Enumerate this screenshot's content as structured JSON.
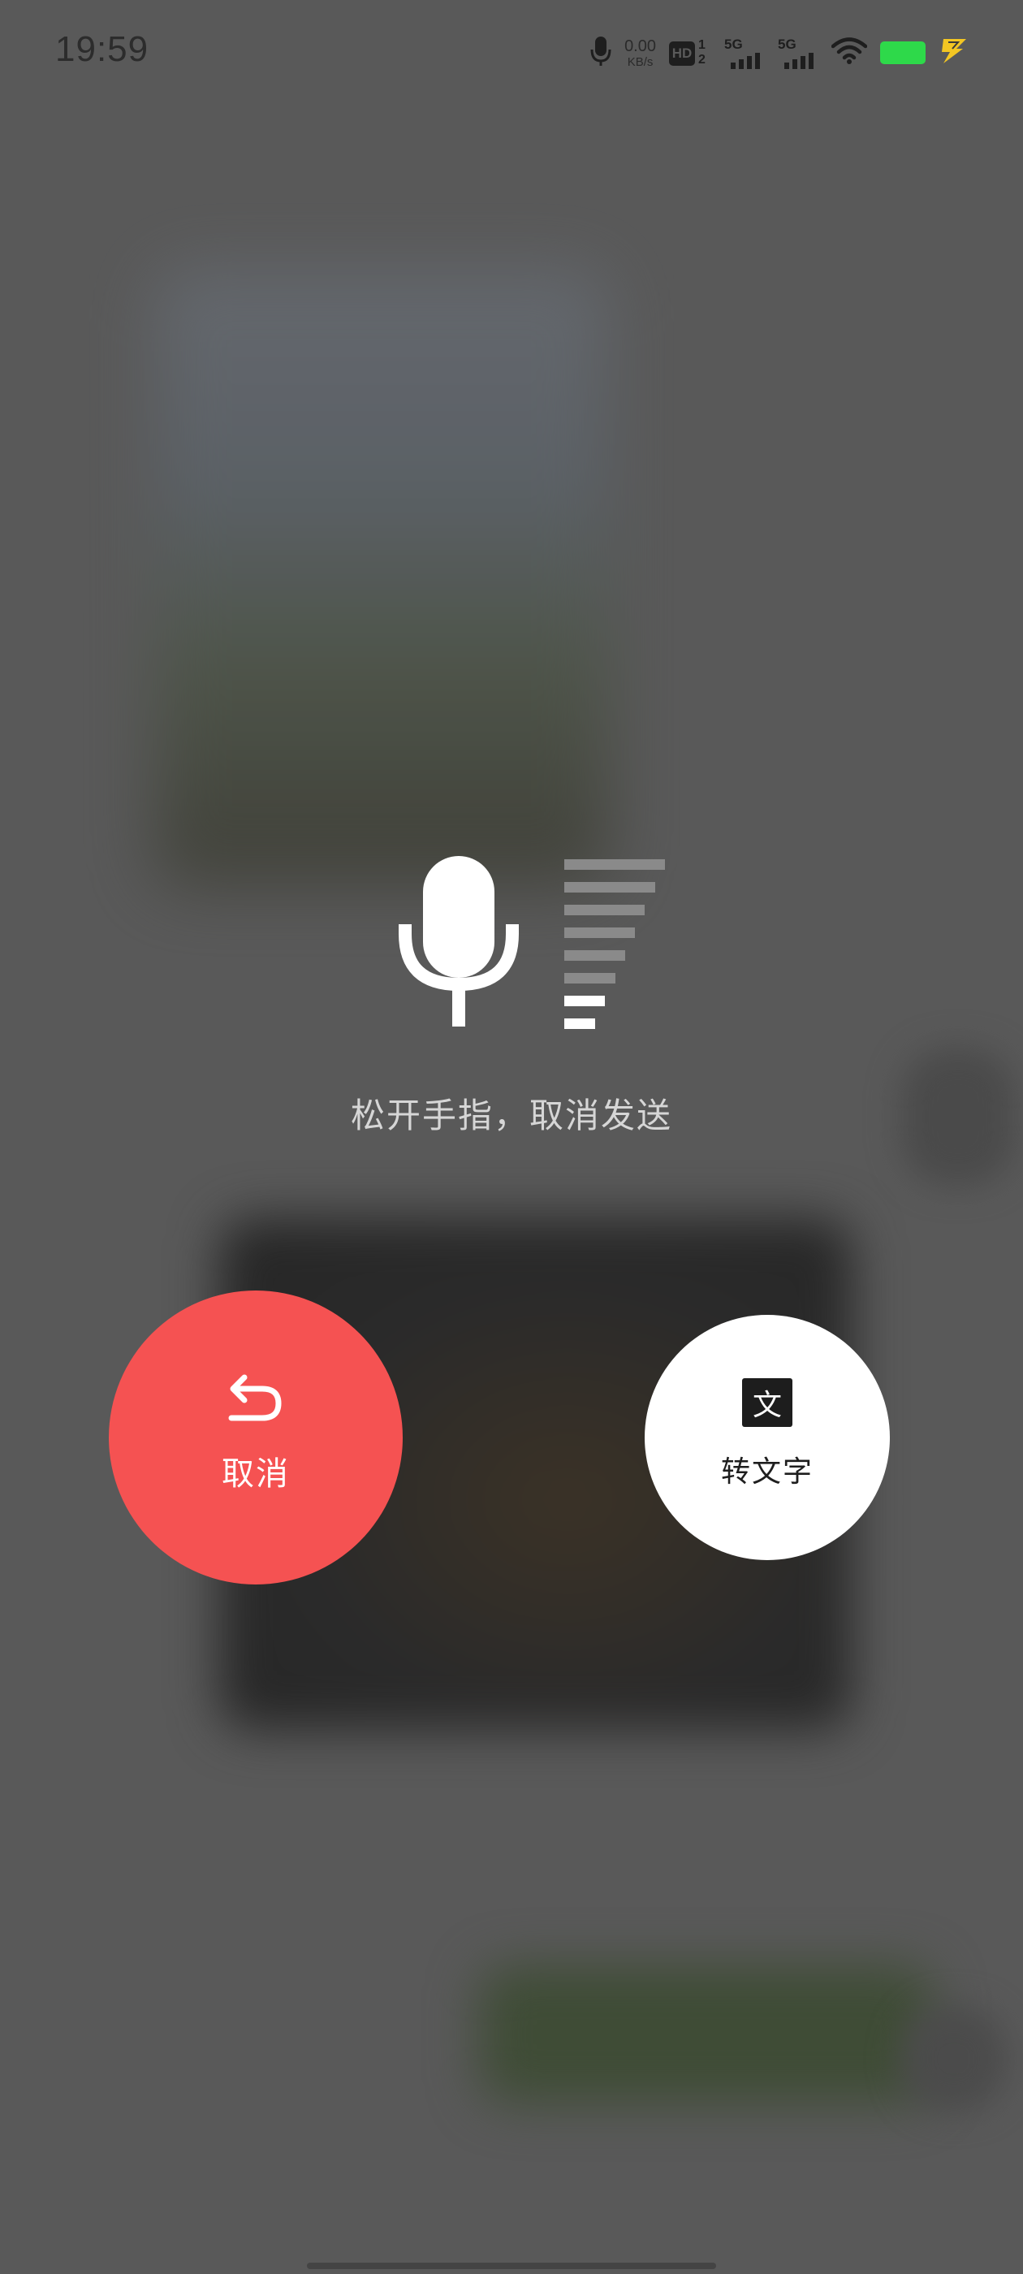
{
  "status_bar": {
    "time": "19:59",
    "net_speed_value": "0.00",
    "net_speed_unit": "KB/s",
    "hd_label": "HD",
    "hd_sim1": "1",
    "hd_sim2": "2",
    "sim1_network": "5G",
    "sim2_network": "5G",
    "battery_color": "#2ed94a",
    "charging_icon_color": "#f3c623",
    "icons": [
      "mic-icon",
      "hd-icon",
      "signal-icon",
      "signal-icon",
      "wifi-icon",
      "battery-icon",
      "charging-icon"
    ]
  },
  "recording": {
    "level_bars_total": 8,
    "level_bars_active": 2,
    "hint": "松开手指，取消发送"
  },
  "actions": {
    "cancel_label": "取消",
    "cancel_color": "#f55252",
    "cancel_icon": "undo-arrow-icon",
    "to_text_label": "转文字",
    "to_text_badge": "文"
  }
}
